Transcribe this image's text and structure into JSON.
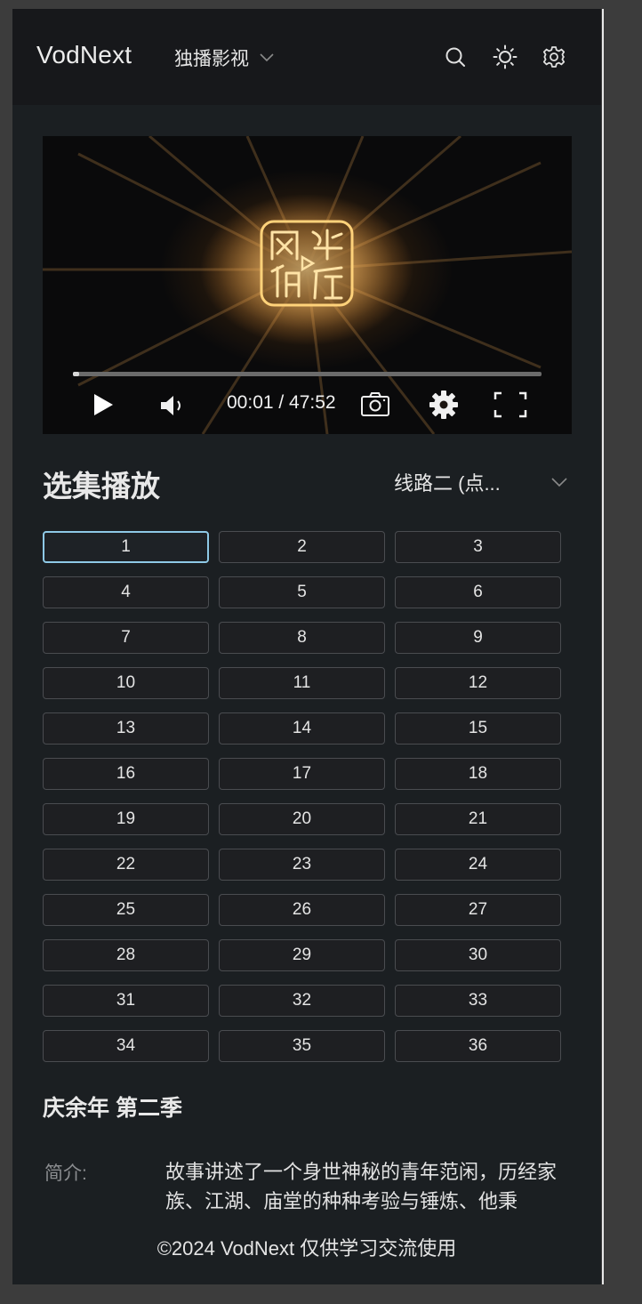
{
  "header": {
    "logo": "VodNext",
    "site_name": "独播影视",
    "icons": [
      "search-icon",
      "theme-sun-icon",
      "settings-gear-icon"
    ]
  },
  "player": {
    "current_time": "00:01",
    "duration": "47:52",
    "time_display": "00:01 / 47:52",
    "progress_fraction": 0.013,
    "controls": [
      "play-icon",
      "volume-icon",
      "screenshot-camera-icon",
      "player-settings-icon",
      "fullscreen-icon"
    ]
  },
  "episodes_section": {
    "title": "选集播放",
    "line_selected": "线路二 (点...",
    "active_episode": "1",
    "episodes": [
      "1",
      "2",
      "3",
      "4",
      "5",
      "6",
      "7",
      "8",
      "9",
      "10",
      "11",
      "12",
      "13",
      "14",
      "15",
      "16",
      "17",
      "18",
      "19",
      "20",
      "21",
      "22",
      "23",
      "24",
      "25",
      "26",
      "27",
      "28",
      "29",
      "30",
      "31",
      "32",
      "33",
      "34",
      "35",
      "36"
    ]
  },
  "info": {
    "title": "庆余年 第二季",
    "desc_label": "简介:",
    "desc_text": "故事讲述了一个身世神秘的青年范闲，历经家族、江湖、庙堂的种种考验与锤炼、他秉"
  },
  "footer": {
    "text": "©2024 VodNext 仅供学习交流使用"
  },
  "colors": {
    "page_bg": "#1b1f22",
    "header_bg": "#17181b",
    "active_border": "#8ec9e6",
    "text": "#e4e4e4"
  }
}
